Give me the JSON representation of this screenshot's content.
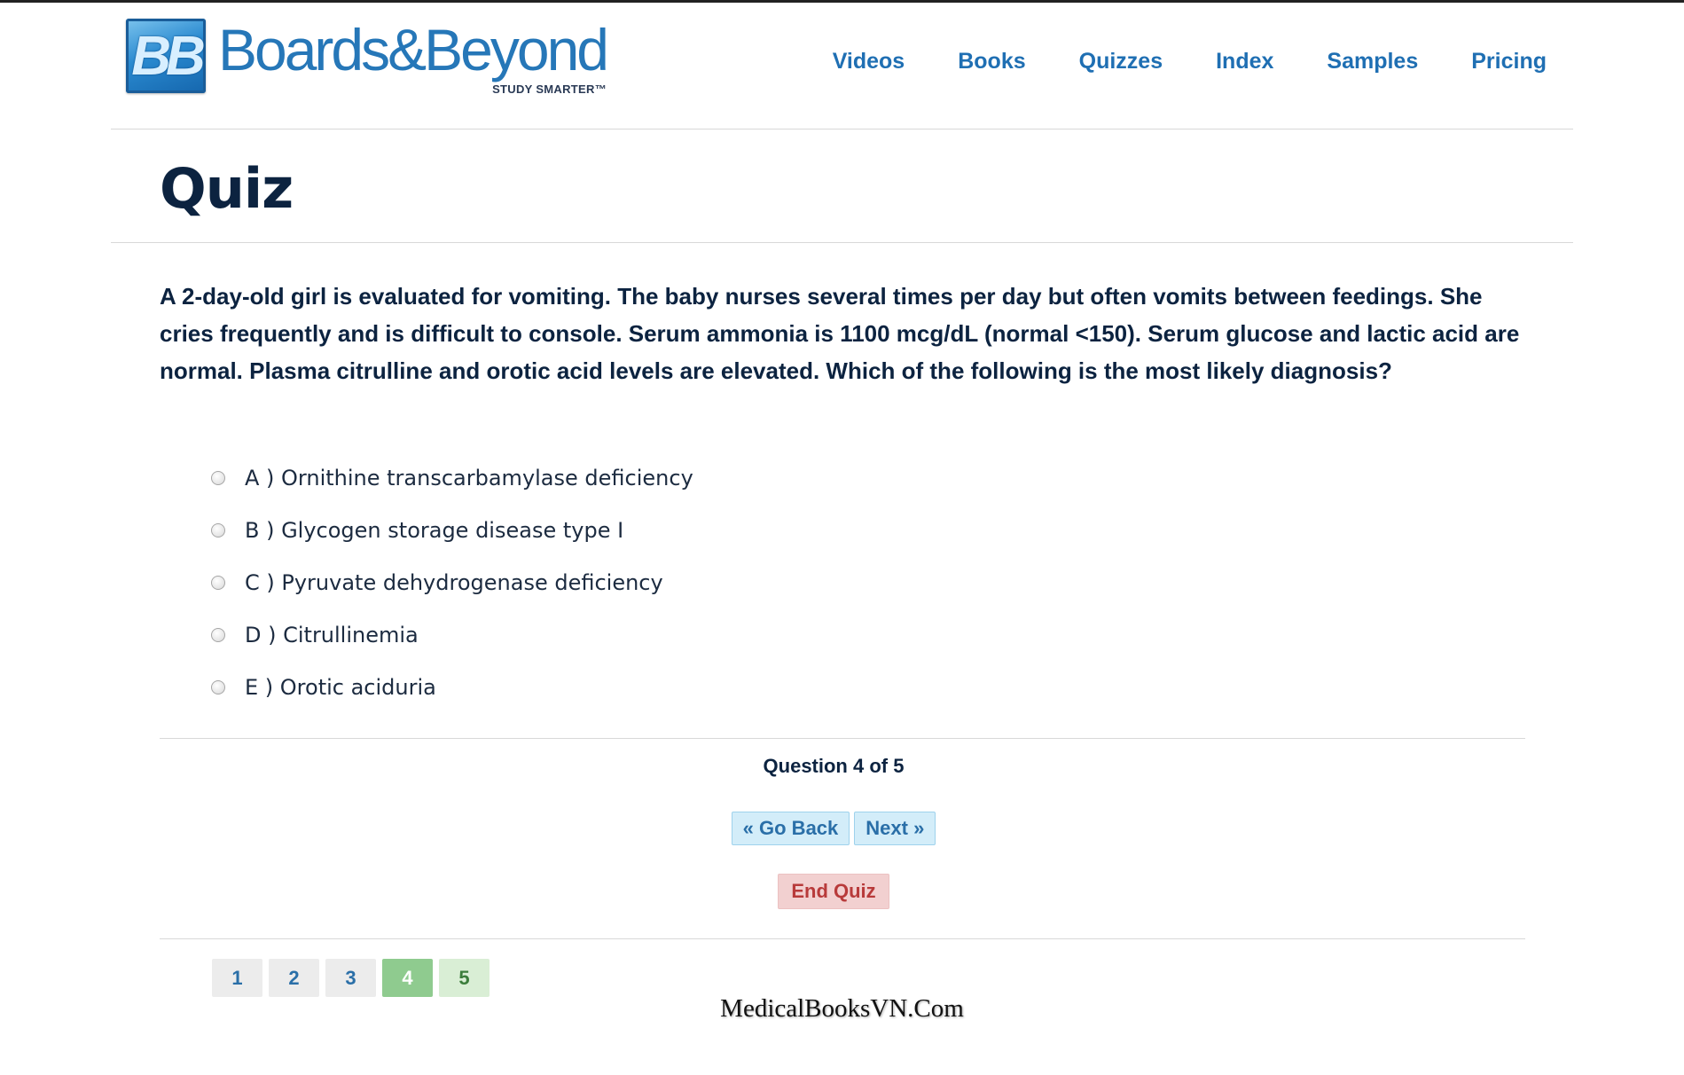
{
  "logo": {
    "mark": "BB",
    "name": "Boards&Beyond",
    "tagline": "STUDY SMARTER™"
  },
  "nav": {
    "items": [
      "Videos",
      "Books",
      "Quizzes",
      "Index",
      "Samples",
      "Pricing"
    ]
  },
  "page": {
    "title": "Quiz"
  },
  "question": {
    "text": "A 2-day-old girl is evaluated for vomiting. The baby nurses several times per day but often vomits between feedings. She cries frequently and is difficult to console. Serum ammonia is 1100 mcg/dL (normal <150). Serum glucose and lactic acid are normal. Plasma citrulline and orotic acid levels are elevated. Which of the following is the most likely diagnosis?",
    "answers": [
      "A ) Ornithine transcarbamylase deficiency",
      "B ) Glycogen storage disease type I",
      "C ) Pyruvate dehydrogenase deficiency",
      "D ) Citrullinemia",
      "E ) Orotic aciduria"
    ]
  },
  "progress": {
    "text": "Question 4 of 5",
    "current": 4,
    "total": 5
  },
  "controls": {
    "back": "« Go Back",
    "next": "Next »",
    "end": "End Quiz"
  },
  "pagination": [
    "1",
    "2",
    "3",
    "4",
    "5"
  ],
  "watermark": "MedicalBooksVN.Com",
  "colors": {
    "brand_blue": "#2677b8",
    "title_navy": "#0c2340",
    "current_page_green": "#8fcb8f",
    "end_quiz_red": "#b83a3a"
  }
}
